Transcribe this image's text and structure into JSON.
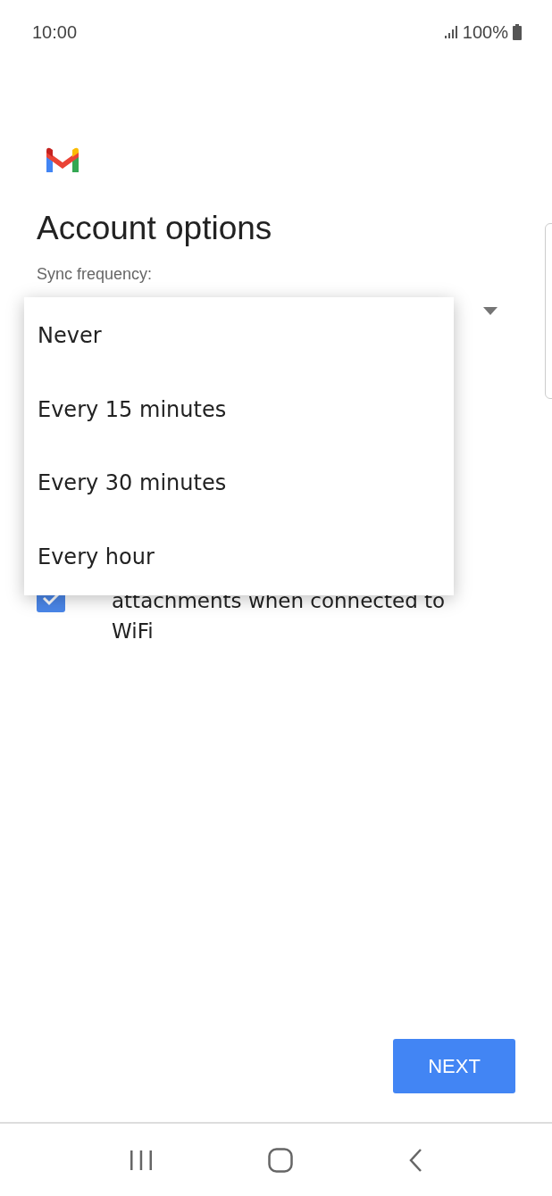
{
  "status_bar": {
    "time": "10:00",
    "battery": "100%"
  },
  "title": "Account options",
  "sync_label": "Sync frequency:",
  "dropdown_options": [
    {
      "label": "Never",
      "selected": false
    },
    {
      "label": "Every 15 minutes",
      "selected": false
    },
    {
      "label": "Every 30 minutes",
      "selected": false
    },
    {
      "label": "Every hour",
      "selected": false
    }
  ],
  "download_option": {
    "label": "attachments when connected to WiFi",
    "checked": true
  },
  "next_button": "NEXT"
}
